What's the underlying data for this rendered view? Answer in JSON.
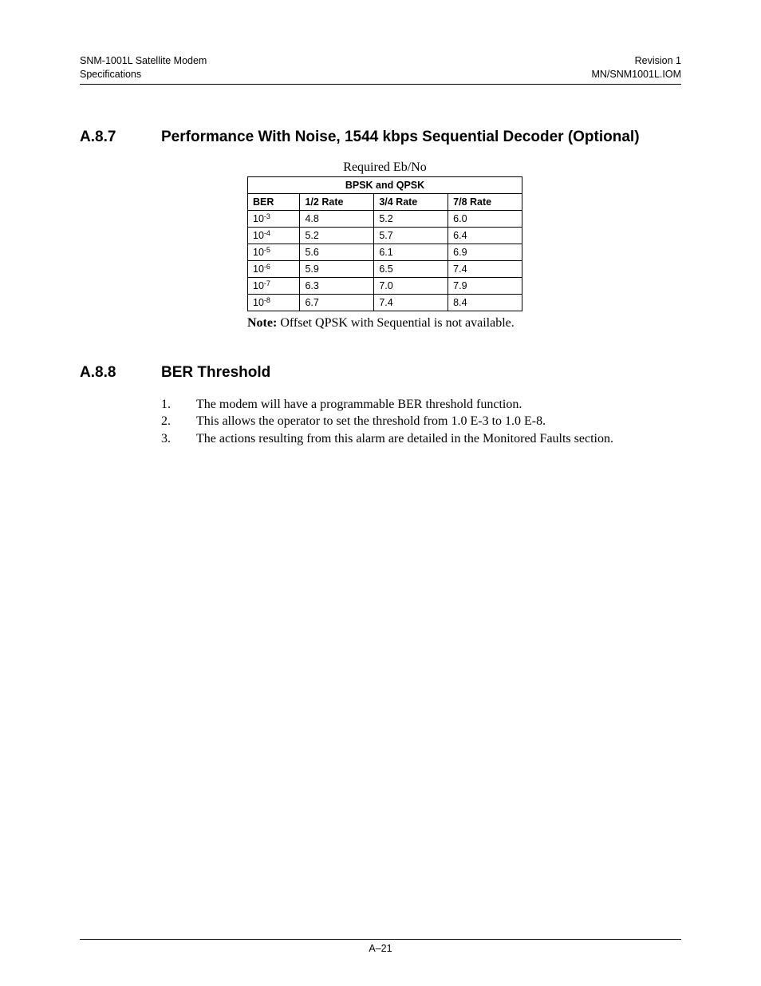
{
  "header": {
    "left_line1": "SNM-1001L Satellite Modem",
    "left_line2": "Specifications",
    "right_line1": "Revision 1",
    "right_line2": "MN/SNM1001L.IOM"
  },
  "section_a87": {
    "number": "A.8.7",
    "title": "Performance With Noise, 1544 kbps Sequential Decoder (Optional)",
    "table": {
      "caption": "Required Eb/No",
      "span_header": "BPSK and QPSK",
      "col_headers": [
        "BER",
        "1/2 Rate",
        "3/4 Rate",
        "7/8 Rate"
      ],
      "rows": [
        {
          "ber_base": "10",
          "ber_exp": "-3",
          "v1": "4.8",
          "v2": "5.2",
          "v3": "6.0"
        },
        {
          "ber_base": "10",
          "ber_exp": "-4",
          "v1": "5.2",
          "v2": "5.7",
          "v3": "6.4"
        },
        {
          "ber_base": "10",
          "ber_exp": "-5",
          "v1": "5.6",
          "v2": "6.1",
          "v3": "6.9"
        },
        {
          "ber_base": "10",
          "ber_exp": "-6",
          "v1": "5.9",
          "v2": "6.5",
          "v3": "7.4"
        },
        {
          "ber_base": "10",
          "ber_exp": "-7",
          "v1": "6.3",
          "v2": "7.0",
          "v3": "7.9"
        },
        {
          "ber_base": "10",
          "ber_exp": "-8",
          "v1": "6.7",
          "v2": "7.4",
          "v3": "8.4"
        }
      ],
      "note_label": "Note:",
      "note_text": " Offset QPSK with Sequential is not available."
    }
  },
  "section_a88": {
    "number": "A.8.8",
    "title": "BER Threshold",
    "items": [
      "The modem will have a programmable BER threshold function.",
      "This allows the operator to set the threshold from 1.0 E-3 to 1.0 E-8.",
      "The actions resulting from this alarm are detailed in the Monitored Faults section."
    ]
  },
  "footer": {
    "page": "A–21"
  }
}
